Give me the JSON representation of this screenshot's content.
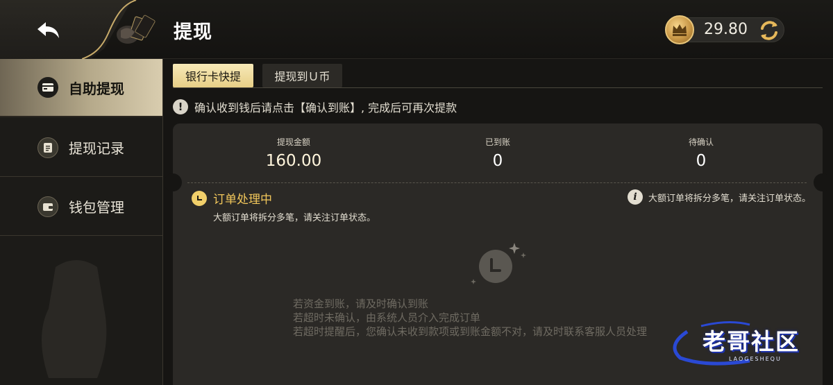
{
  "header": {
    "title": "提现",
    "balance": "29.80"
  },
  "sidebar": {
    "items": [
      {
        "label": "自助提现",
        "active": true,
        "icon": "card-icon"
      },
      {
        "label": "提现记录",
        "active": false,
        "icon": "record-icon"
      },
      {
        "label": "钱包管理",
        "active": false,
        "icon": "wallet-icon"
      }
    ]
  },
  "tabs": [
    {
      "label": "银行卡快提",
      "active": true
    },
    {
      "label": "提现到Ｕ币",
      "active": false
    }
  ],
  "notice": {
    "text": "确认收到钱后请点击【确认到账】, 完成后可再次提款"
  },
  "stats": [
    {
      "label": "提现金额",
      "value": "160.00"
    },
    {
      "label": "已到账",
      "value": "0"
    },
    {
      "label": "待确认",
      "value": "0"
    }
  ],
  "order": {
    "status": "订单处理中",
    "sub": "大额订单将拆分多笔，请关注订单状态。",
    "split_tip": "大额订单将拆分多笔，请关注订单状态。"
  },
  "hints": [
    "若资金到账，请及时确认到账",
    "若超时未确认，由系统人员介入完成订单",
    "若超时提醒后，您确认未收到款项或到账金额不对，请及时联系客服人员处理"
  ],
  "watermark": {
    "text": "老哥社区",
    "sub": "LAOGESHEQU"
  },
  "colors": {
    "accent_gold": "#f2c75b",
    "tab_active": "#e7cf87",
    "background": "#161513",
    "card": "#2b2926"
  }
}
